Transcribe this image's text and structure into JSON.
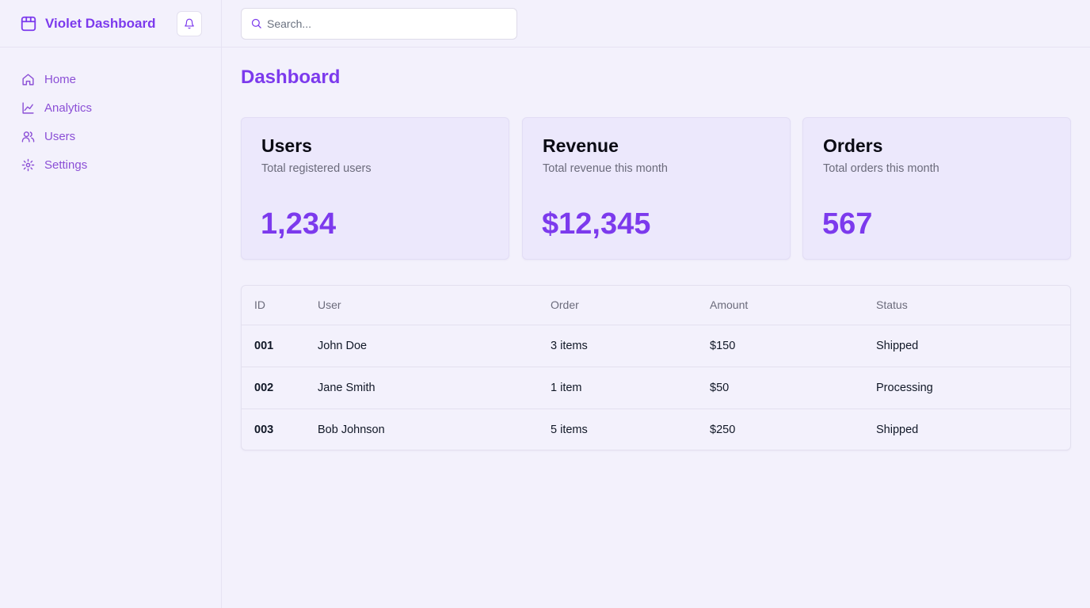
{
  "brand": {
    "name": "Violet Dashboard"
  },
  "sidebar": {
    "items": [
      {
        "label": "Home",
        "icon": "home-icon"
      },
      {
        "label": "Analytics",
        "icon": "chart-icon"
      },
      {
        "label": "Users",
        "icon": "users-icon"
      },
      {
        "label": "Settings",
        "icon": "gear-icon"
      }
    ]
  },
  "search": {
    "placeholder": "Search...",
    "value": ""
  },
  "page": {
    "title": "Dashboard"
  },
  "cards": [
    {
      "title": "Users",
      "subtitle": "Total registered users",
      "value": "1,234"
    },
    {
      "title": "Revenue",
      "subtitle": "Total revenue this month",
      "value": "$12,345"
    },
    {
      "title": "Orders",
      "subtitle": "Total orders this month",
      "value": "567"
    }
  ],
  "table": {
    "columns": [
      "ID",
      "User",
      "Order",
      "Amount",
      "Status"
    ],
    "rows": [
      {
        "id": "001",
        "user": "John Doe",
        "order": "3 items",
        "amount": "$150",
        "status": "Shipped"
      },
      {
        "id": "002",
        "user": "Jane Smith",
        "order": "1 item",
        "amount": "$50",
        "status": "Processing"
      },
      {
        "id": "003",
        "user": "Bob Johnson",
        "order": "5 items",
        "amount": "$250",
        "status": "Shipped"
      }
    ]
  },
  "colors": {
    "accent": "#7c3aed",
    "nav": "#8b4fd6",
    "background": "#f3f1fc",
    "card": "#ece8fc"
  }
}
